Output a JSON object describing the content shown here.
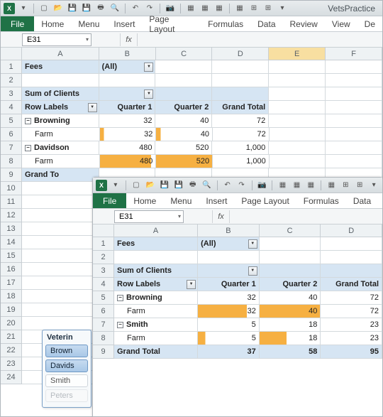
{
  "qat_icons": [
    "new",
    "open",
    "save",
    "save-as",
    "print",
    "undo",
    "redo",
    "copy",
    "paste",
    "grid",
    "table1",
    "table2",
    "table3",
    "border1",
    "border2",
    "border3"
  ],
  "app_title": "VetsPractice",
  "ribbon": {
    "file": "File",
    "tabs": [
      "Home",
      "Menu",
      "Insert",
      "Page Layout",
      "Formulas",
      "Data",
      "Review",
      "View",
      "De"
    ]
  },
  "ribbon2": {
    "file": "File",
    "tabs": [
      "Home",
      "Menu",
      "Insert",
      "Page Layout",
      "Formulas",
      "Data"
    ]
  },
  "namebox": "E31",
  "fx": "fx",
  "cols": [
    "A",
    "B",
    "C",
    "D",
    "E",
    "F"
  ],
  "cols2": [
    "A",
    "B",
    "C",
    "D"
  ],
  "rows": [
    "1",
    "2",
    "3",
    "4",
    "5",
    "6",
    "7",
    "8",
    "9",
    "10",
    "11",
    "12",
    "13",
    "14",
    "15",
    "16",
    "17",
    "18",
    "19",
    "20",
    "21",
    "22",
    "23",
    "24"
  ],
  "rows2": [
    "1",
    "2",
    "3",
    "4",
    "5",
    "6",
    "7",
    "8",
    "9"
  ],
  "pt": {
    "fees": "Fees",
    "all": "(All)",
    "sum": "Sum of Clients",
    "rowlabels": "Row Labels",
    "q1": "Quarter 1",
    "q2": "Quarter 2",
    "gt": "Grand Total",
    "browning": "Browning",
    "farm": "Farm",
    "davidson": "Davidson",
    "smith": "Smith",
    "grandtotal_trunc": "Grand To",
    "v": {
      "br_q1": "32",
      "br_q2": "40",
      "br_gt": "72",
      "brf_q1": "32",
      "brf_q2": "40",
      "brf_gt": "72",
      "dv_q1": "480",
      "dv_q2": "520",
      "dv_gt": "1,000",
      "dvf_q1": "480",
      "dvf_q2": "520",
      "dvf_gt": "1,000"
    },
    "v2": {
      "br_q1": "32",
      "br_q2": "40",
      "br_gt": "72",
      "brf_q1": "32",
      "brf_q2": "40",
      "brf_gt": "72",
      "sm_q1": "5",
      "sm_q2": "18",
      "sm_gt": "23",
      "smf_q1": "5",
      "smf_q2": "18",
      "smf_gt": "23",
      "gt_q1": "37",
      "gt_q2": "58",
      "gt_gt": "95"
    }
  },
  "slicer": {
    "title": "Veterin",
    "items": [
      "Brown",
      "Davids",
      "Smith",
      "Peters"
    ]
  },
  "icons": {
    "dd": "▼",
    "minus": "−",
    "tri": "▾"
  }
}
